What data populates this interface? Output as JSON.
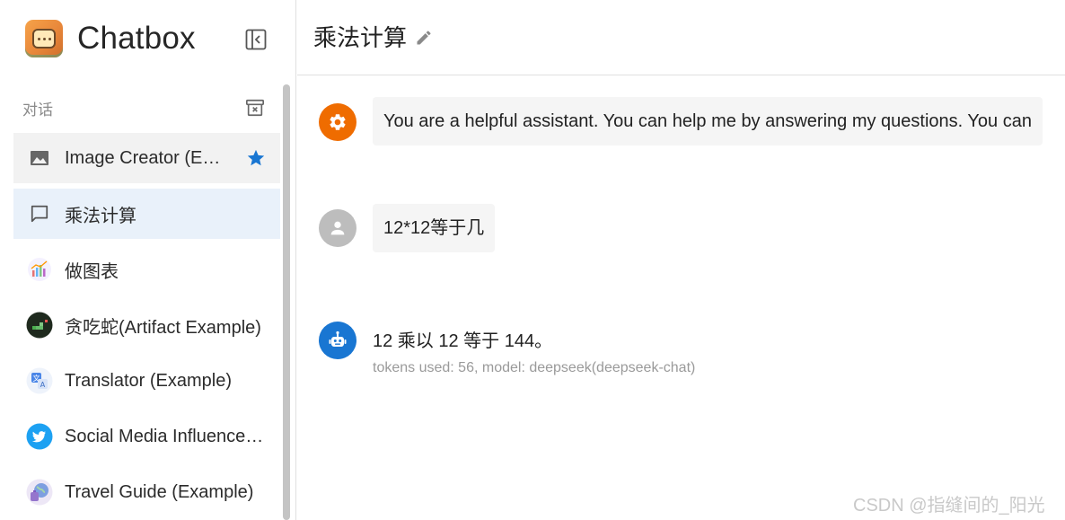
{
  "app": {
    "name": "Chatbox"
  },
  "sidebar": {
    "section_title": "对话",
    "sessions": [
      {
        "label": "Image Creator (E…",
        "icon": "image-icon",
        "starred": true
      },
      {
        "label": "乘法计算",
        "icon": "chat-bubble-icon",
        "active": true
      },
      {
        "label": "做图表",
        "icon": "chart-avatar-icon"
      },
      {
        "label": "贪吃蛇(Artifact Example)",
        "icon": "snake-game-avatar-icon"
      },
      {
        "label": "Translator (Example)",
        "icon": "translate-avatar-icon"
      },
      {
        "label": "Social Media Influence…",
        "icon": "twitter-bird-avatar-icon"
      },
      {
        "label": "Travel Guide (Example)",
        "icon": "travel-avatar-icon"
      }
    ]
  },
  "main": {
    "title": "乘法计算",
    "messages": [
      {
        "role": "system",
        "text": "You are a helpful assistant. You can help me by answering my questions. You can"
      },
      {
        "role": "user",
        "text": "12*12等于几"
      },
      {
        "role": "assistant",
        "text": "12 乘以 12 等于 144。",
        "meta": "tokens used: 56, model: deepseek(deepseek-chat)"
      }
    ]
  },
  "watermark": "CSDN @指缝间的_阳光",
  "colors": {
    "system_avatar": "#ef6c00",
    "user_avatar": "#bdbdbd",
    "assistant_avatar": "#1976d2",
    "star": "#1976d2",
    "active_item_bg": "#e9f1fa"
  }
}
